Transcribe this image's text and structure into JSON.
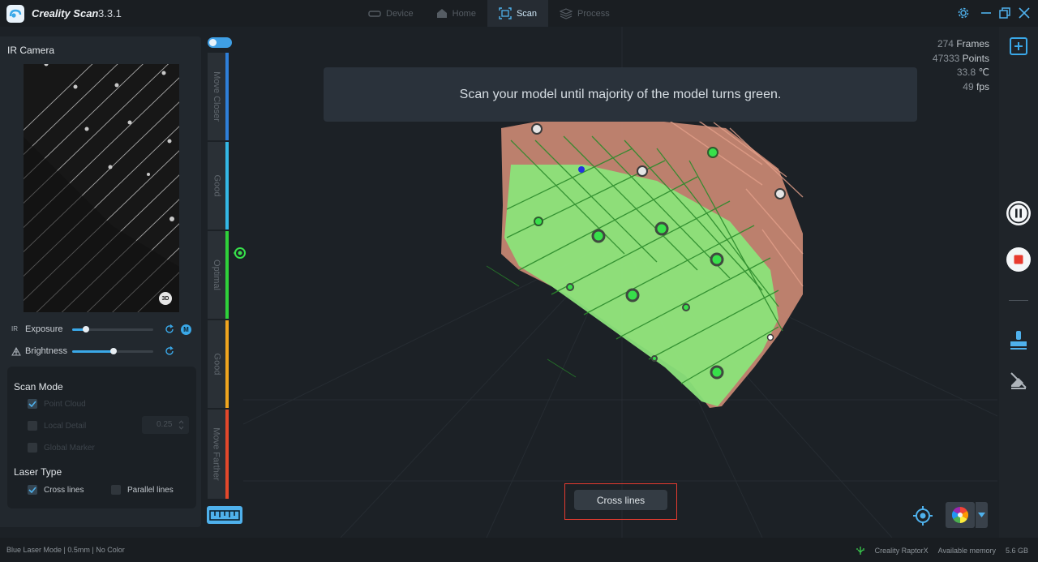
{
  "app": {
    "name": "Creality Scan",
    "version": "3.3.1"
  },
  "nav": {
    "tabs": [
      {
        "label": "Device"
      },
      {
        "label": "Home"
      },
      {
        "label": "Scan"
      },
      {
        "label": "Process"
      }
    ],
    "active": "Scan"
  },
  "camera": {
    "title": "IR Camera",
    "badge": "3D"
  },
  "exposure": {
    "prefix": "IR",
    "label": "Exposure",
    "level": 0.17,
    "mode_badge": "M"
  },
  "brightness": {
    "label": "Brightness",
    "level": 0.51
  },
  "scan_mode": {
    "title": "Scan Mode",
    "options": [
      {
        "label": "Point Cloud",
        "checked": true
      },
      {
        "label": "Local Detail",
        "checked": false
      },
      {
        "label": "Global Marker",
        "checked": false
      }
    ],
    "detail_value": "0.25"
  },
  "laser_type": {
    "title": "Laser Type",
    "options": [
      {
        "label": "Cross lines",
        "checked": true
      },
      {
        "label": "Parallel lines",
        "checked": false
      }
    ]
  },
  "distance": {
    "segments": [
      {
        "label": "Move Closer",
        "color": "#2e7fd9"
      },
      {
        "label": "Good",
        "color": "#33b8e6"
      },
      {
        "label": "Optimal",
        "color": "#2fd13a"
      },
      {
        "label": "Good",
        "color": "#f0a51e"
      },
      {
        "label": "Move Farther",
        "color": "#e3482b"
      }
    ]
  },
  "hint": "Scan your model until majority of the model turns green.",
  "stats": {
    "frames": {
      "value": "274",
      "unit": "Frames"
    },
    "points": {
      "value": "47333",
      "unit": "Points"
    },
    "temp": {
      "value": "33.8",
      "unit": "℃"
    },
    "fps": {
      "value": "49",
      "unit": "fps"
    }
  },
  "laser_button": "Cross lines",
  "status": {
    "left": "Blue Laser Mode | 0.5mm | No Color",
    "device": "Creality RaptorX",
    "memory_label": "Available memory",
    "memory_value": "5.6 GB"
  },
  "icons": {
    "device": "device-icon",
    "home": "home-icon",
    "scan": "scan-icon",
    "process": "process-icon",
    "settings": "gear-icon",
    "minimize": "minimize-icon",
    "restore": "restore-icon",
    "close": "close-icon",
    "add": "add-square-icon",
    "pause": "pause-icon",
    "stop": "stop-icon",
    "brush": "brush-icon",
    "erase": "eraser-off-icon",
    "target": "target-icon",
    "color": "color-wheel-icon",
    "dropdown": "chevron-down-icon",
    "ruler": "ruler-icon"
  }
}
